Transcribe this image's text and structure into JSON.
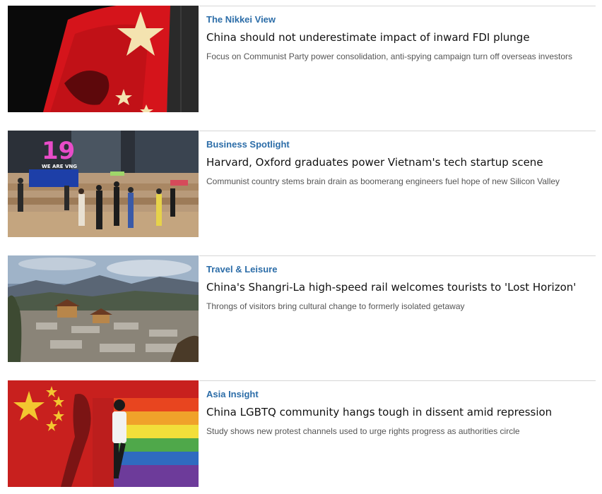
{
  "articles": [
    {
      "section": "The Nikkei View",
      "headline": "China should not underestimate impact of inward FDI plunge",
      "dek": "Focus on Communist Party power consolidation, anti-spying campaign turn off overseas investors",
      "image": "chinese-flag-shadow-photo"
    },
    {
      "section": "Business Spotlight",
      "headline": "Harvard, Oxford graduates power Vietnam's tech startup scene",
      "dek": "Communist country stems brain drain as boomerang engineers fuel hope of new Silicon Valley",
      "image": "startup-office-event-photo",
      "image_sign": "19",
      "image_banner": "WE ARE VNG"
    },
    {
      "section": "Travel & Leisure",
      "headline": "China's Shangri-La high-speed rail welcomes tourists to 'Lost Horizon'",
      "dek": "Throngs of visitors bring cultural change to formerly isolated getaway",
      "image": "shangri-la-town-photo"
    },
    {
      "section": "Asia Insight",
      "headline": "China LGBTQ community hangs tough in dissent amid repression",
      "dek": "Study shows new protest channels used to urge rights progress as authorities circle",
      "image": "rainbow-flag-illustration"
    }
  ],
  "colors": {
    "section_link": "#2c6da8",
    "headline": "#111111",
    "dek": "#555555",
    "divider": "#d6d6d6"
  }
}
